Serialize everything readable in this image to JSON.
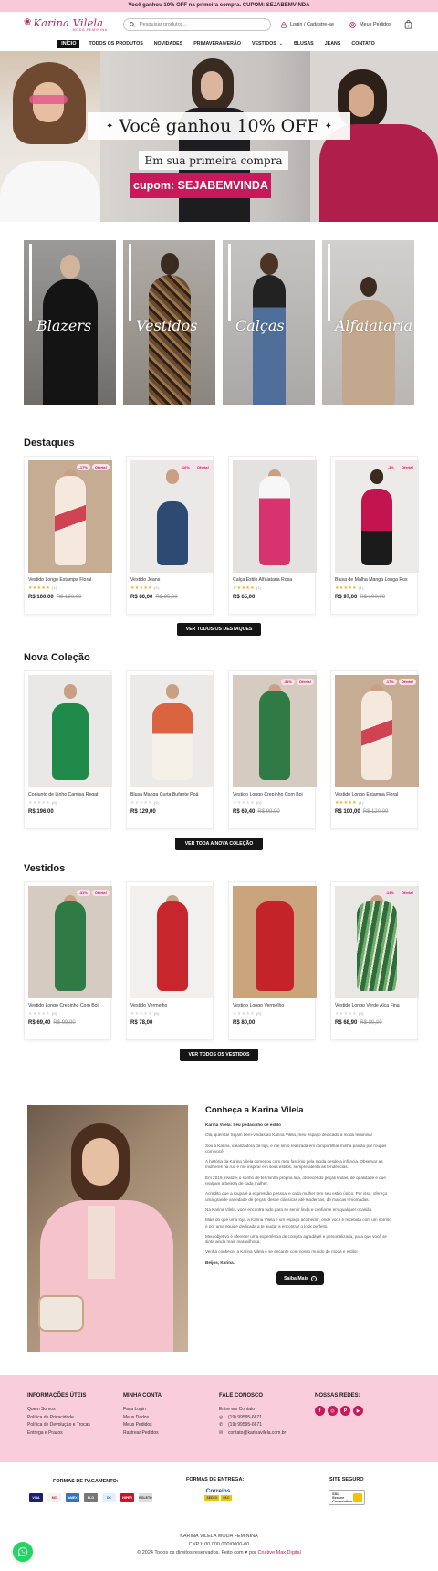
{
  "announcement": "Você ganhou 10% OFF na primeira compra. CUPOM: SEJABEMVINDA",
  "header": {
    "logo_text": "Karina Vilela",
    "logo_subtext": "MODA FEMININA",
    "search_placeholder": "Pesquisar produtos...",
    "login_label": "Login / Cadastre-se",
    "orders_label": "Meus Pedidos",
    "cart_count": "0"
  },
  "nav": {
    "items": [
      "INÍCIO",
      "TODOS OS PRODUTOS",
      "NOVIDADES",
      "PRIMAVERA/VERÃO",
      "VESTIDOS",
      "BLUSAS",
      "JEANS",
      "CONTATO"
    ]
  },
  "hero": {
    "title": "Você ganhou 10% OFF",
    "subtitle": "Em sua primeira compra",
    "coupon": "cupom: SEJABEMVINDA"
  },
  "categories": [
    "Blazers",
    "Vestidos",
    "Calças",
    "Alfaiataria"
  ],
  "destaques": {
    "title": "Destaques",
    "button": "VER TODOS OS DESTAQUES",
    "products": [
      {
        "name": "Vestido Longo Estampa Floral",
        "price": "R$ 100,00",
        "old_price": "R$ 120,00",
        "discount": "-17%",
        "offer": "Oferta!",
        "count": "(1)"
      },
      {
        "name": "Vestido Jeans",
        "price": "R$ 80,00",
        "old_price": "R$ 95,00",
        "discount": "-16%",
        "offer": "Oferta!",
        "count": "(1)"
      },
      {
        "name": "Calça Estilo Alfaiataria Rosa",
        "price": "R$ 65,00",
        "old_price": "",
        "discount": "",
        "offer": "",
        "count": "(1)"
      },
      {
        "name": "Blusa de Malha Manga Longa Ros",
        "price": "R$ 97,00",
        "old_price": "R$ 100,00",
        "discount": "-3%",
        "offer": "Oferta!",
        "count": "(1)"
      }
    ]
  },
  "nova_colecao": {
    "title": "Nova Coleção",
    "button": "VER TODA A NOVA COLEÇÃO",
    "products": [
      {
        "name": "Conjunto de Linho Camisa Regat",
        "price": "R$ 196,00",
        "old_price": "",
        "discount": "",
        "offer": "",
        "count": "(0)"
      },
      {
        "name": "Blusa Manga Curta Bufante Poá",
        "price": "R$ 129,00",
        "old_price": "",
        "discount": "",
        "offer": "",
        "count": "(0)"
      },
      {
        "name": "Vestido Longo Crepinho Com Boj",
        "price": "R$ 69,40",
        "old_price": "R$ 99,90",
        "discount": "-31%",
        "offer": "Oferta!",
        "count": "(0)"
      },
      {
        "name": "Vestido Longo Estampa Floral",
        "price": "R$ 100,00",
        "old_price": "R$ 120,00",
        "discount": "-17%",
        "offer": "Oferta!",
        "count": "(1)"
      }
    ]
  },
  "vestidos": {
    "title": "Vestidos",
    "button": "VER TODOS OS VESTIDOS",
    "products": [
      {
        "name": "Vestido Longo Crepinho Com Boj",
        "price": "R$ 69,40",
        "old_price": "R$ 99,90",
        "discount": "-31%",
        "offer": "Oferta!",
        "count": "(0)"
      },
      {
        "name": "Vestido Vermelho",
        "price": "R$ 78,00",
        "old_price": "",
        "discount": "",
        "offer": "",
        "count": "(0)"
      },
      {
        "name": "Vestido Longo Vermelho",
        "price": "R$ 80,00",
        "old_price": "",
        "discount": "",
        "offer": "",
        "count": "(0)"
      },
      {
        "name": "Vestido Longo Verde Alça Fina",
        "price": "R$ 68,90",
        "old_price": "R$ 80,00",
        "discount": "-14%",
        "offer": "Oferta!",
        "count": "(0)"
      }
    ]
  },
  "about": {
    "title": "Conheça a Karina Vilela",
    "lead": "Karina Vilela: Seu pedacinho de estilo",
    "paragraphs": [
      "Olá, querida! Sejam bem-vindas ao Karina Vilela, meu espaço dedicado à moda feminina!",
      "Sou a Karina, idealizadora da loja, e me sinto realizada em compartilhar minha paixão por roupas com você.",
      "A história da Karina Vilela começou com meu fascínio pela moda desde a infância. Observar as mulheres na rua e me inspirar em seus estilos, sempre atenta às tendências.",
      "Em 2018, realizei o sonho de ter minha própria loja, oferecendo peças lindas, de qualidade e que realçam a beleza de cada mulher.",
      "Acredito que a roupa é a expressão pessoal e cada mulher tem seu estilo único. Por isso, ofereço uma grande variedade de peças, desde clássicas até modernas, de marcas renomadas.",
      "Na Karina Vilela, você encontra tudo para se sentir linda e confiante em qualquer ocasião.",
      "Mais do que uma loja, a Karina Vilela é um espaço acolhedor, onde você é recebida com um sorriso e por uma equipe dedicada a te ajudar a encontrar o look perfeito.",
      "Meu objetivo é oferecer uma experiência de compra agradável e personalizada, para que você se sinta ainda mais maravilhosa.",
      "Venha conhecer a Karina Vilela e se encante com nosso mundo de moda e estilo!"
    ],
    "signature": "Beijos, Karina.",
    "button": "Saiba Mais"
  },
  "footer": {
    "info_title": "INFORMAÇÕES ÚTEIS",
    "info_items": [
      "Quem Somos",
      "Política de Privacidade",
      "Política de Devolução e Trocas",
      "Entrega e Prazos"
    ],
    "account_title": "MINHA CONTA",
    "account_items": [
      "Faça Login",
      "Meus Dados",
      "Meus Pedidos",
      "Rastrear Pedidos"
    ],
    "contact_title": "FALE CONOSCO",
    "contact_items": [
      "Entre em Contato",
      "(19) 99595-6671",
      "(19) 99595-6671",
      "contato@karinavilela.com.br"
    ],
    "social_title": "NOSSAS REDES:",
    "payment_title": "FORMAS DE PAGAMENTO:",
    "payment_methods": [
      "VISA",
      "MC",
      "AMEX",
      "ELO",
      "DC",
      "HIPER",
      "BOLETO"
    ],
    "shipping_title": "FORMAS DE ENTREGA:",
    "shipping_brand": "Correios",
    "shipping_services": [
      "SEDEX",
      "PAC"
    ],
    "security_title": "SITE SEGURO",
    "security_badge": "SSL Secure Connection",
    "company": "KARINA VILELA MODA FEMININA",
    "cnpj": "CNPJ: 00.000.000/0000-00",
    "copyright": "© 2024 Todos os direitos reservados. Feito com",
    "by": "por",
    "agency": "Criative Max Digital"
  },
  "colors": {
    "accent": "#c8195b",
    "topbar": "#f7c9d9",
    "footer_pink": "#f9cddc"
  }
}
